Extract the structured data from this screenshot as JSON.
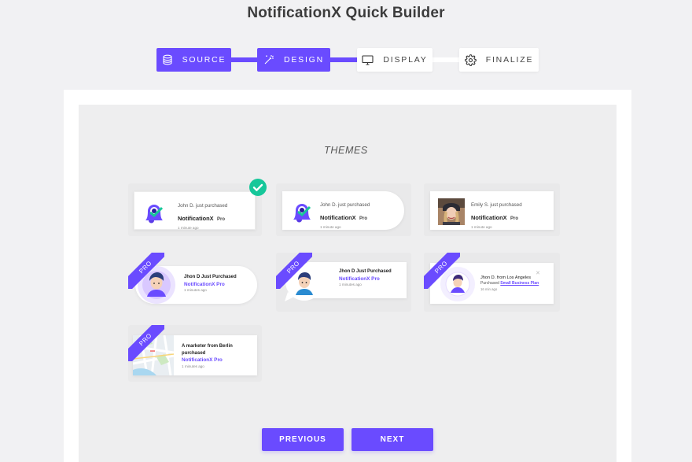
{
  "page": {
    "title": "NotificationX Quick Builder"
  },
  "colors": {
    "accent": "#6a4bff",
    "check": "#16c79a",
    "background": "#f1f1f3"
  },
  "steps": [
    {
      "label": "SOURCE",
      "icon": "database-icon",
      "state": "completed"
    },
    {
      "label": "DESIGN",
      "icon": "magic-wand-icon",
      "state": "active"
    },
    {
      "label": "DISPLAY",
      "icon": "monitor-icon",
      "state": "inactive"
    },
    {
      "label": "FINALIZE",
      "icon": "gear-icon",
      "state": "inactive"
    }
  ],
  "themes_title": "THEMES",
  "themes": [
    {
      "id": 1,
      "selected": true,
      "pro": false,
      "line1": "John D. just purchased",
      "product": "NotificationX",
      "product_suffix": "Pro",
      "time": "1 minute ago"
    },
    {
      "id": 2,
      "selected": false,
      "pro": false,
      "line1": "John D. just purchased",
      "product": "NotificationX",
      "product_suffix": "Pro",
      "time": "1 minute ago"
    },
    {
      "id": 3,
      "selected": false,
      "pro": false,
      "line1": "Emily S. just purchased",
      "product": "NotificationX",
      "product_suffix": "Pro",
      "time": "1 minute ago"
    },
    {
      "id": 4,
      "selected": false,
      "pro": true,
      "ribbon": "PRO",
      "line1": "Jhon D Just Purchased",
      "product": "NotificationX Pro",
      "time": "1 minutes ago"
    },
    {
      "id": 5,
      "selected": false,
      "pro": true,
      "ribbon": "PRO",
      "line1": "Jhon D Just Purchased",
      "product": "NotificationX Pro",
      "time": "1 minutes ago"
    },
    {
      "id": 6,
      "selected": false,
      "pro": true,
      "ribbon": "PRO",
      "line1": "Jhon D. from Los Angeles",
      "line2_prefix": "Purchased",
      "product": "Small Business Plan",
      "time": "16 min ago"
    },
    {
      "id": 7,
      "selected": false,
      "pro": true,
      "ribbon": "PRO",
      "line1": "A marketer from Berlin purchased",
      "product": "NotificationX Pro",
      "time": "1 minutes ago"
    }
  ],
  "buttons": {
    "previous": "PREVIOUS",
    "next": "NEXT"
  }
}
